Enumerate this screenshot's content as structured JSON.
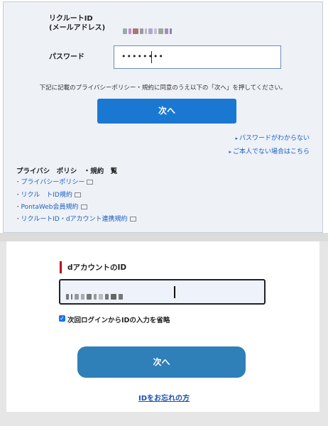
{
  "login": {
    "id_label_line1": "リクルートID",
    "id_label_line2": "(メールアドレス)",
    "password_label": "パスワード",
    "password_value": "••••••••",
    "notice": "下記に記載のプライバシーポリシー・規約に同意のうえ以下の「次へ」を押してください。",
    "next_button": "次へ",
    "links": {
      "forgot_password": "パスワードがわからない",
      "not_you": "ご本人でない場合はこちら"
    },
    "privacy_heading": "プライバシ　ポリシ　・規約　覧",
    "privacy_items": [
      "プライバシーポリシー",
      "リクル　トID規約",
      "PontaWeb会員規約",
      "リクルートID・dアカウント連携規約"
    ]
  },
  "daccount": {
    "title": "dアカウントのID",
    "remember_label": "次回ログインからIDの入力を省略",
    "remember_checked": true,
    "next_button": "次へ",
    "forgot_id": "IDをお忘れの方"
  },
  "colors": {
    "primary_blue": "#1a78d2",
    "secondary_blue": "#2f7fb8",
    "link_blue": "#1a5fc7",
    "accent_red": "#c00020"
  }
}
